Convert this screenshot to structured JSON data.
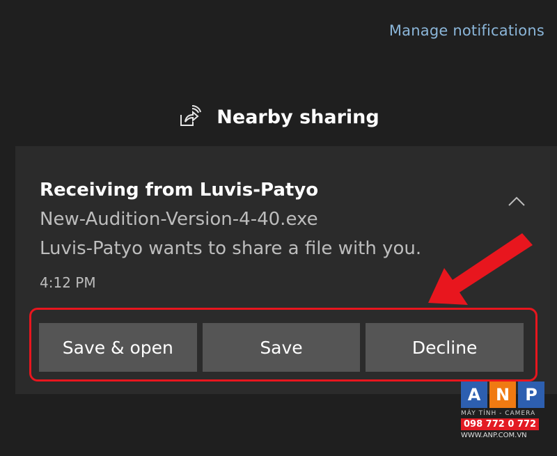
{
  "header": {
    "manage_link": "Manage notifications"
  },
  "group": {
    "icon": "nearby-sharing-icon",
    "title": "Nearby sharing"
  },
  "toast": {
    "title": "Receiving from Luvis-Patyo",
    "filename": "New-Audition-Version-4-40.exe",
    "message": "Luvis-Patyo wants to share a file with you.",
    "time": "4:12 PM",
    "collapse_icon": "chevron-up-icon",
    "actions": {
      "save_open": "Save & open",
      "save": "Save",
      "decline": "Decline"
    }
  },
  "annotation": {
    "highlight_color": "#e8161e"
  },
  "watermark": {
    "letters": [
      "A",
      "N",
      "P"
    ],
    "subtitle": "MÁY TÍNH - CAMERA",
    "phone": "098 772 0 772",
    "site": "WWW.ANP.COM.VN"
  },
  "colors": {
    "background": "#1f1f1f",
    "toast_background": "#2b2b2b",
    "button_background": "#555555",
    "link": "#8bb6d9"
  }
}
